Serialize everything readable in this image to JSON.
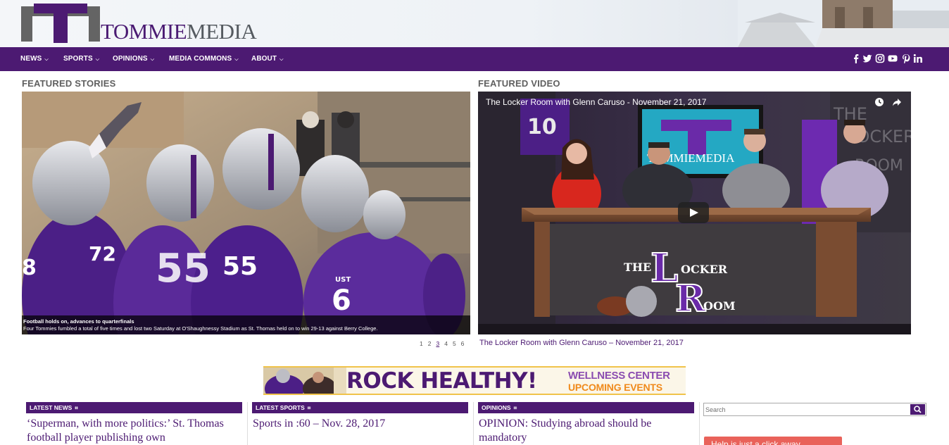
{
  "site": {
    "logo_text_part1": "TOMMIE",
    "logo_text_part2": "MEDIA",
    "brand_color": "#4c1a72"
  },
  "nav": {
    "items": [
      {
        "label": "NEWS"
      },
      {
        "label": "SPORTS"
      },
      {
        "label": "OPINIONS"
      },
      {
        "label": "MEDIA COMMONS"
      },
      {
        "label": "ABOUT"
      }
    ],
    "social_icons": [
      "facebook-icon",
      "twitter-icon",
      "instagram-icon",
      "youtube-icon",
      "pinterest-icon",
      "linkedin-icon"
    ]
  },
  "featured_stories": {
    "heading": "FEATURED STORIES",
    "caption_title": "Football holds on, advances to quarterfinals",
    "caption_text": "Four Tommies fumbled a total of five times and lost two Saturday at O'Shaughnessy Stadium as St. Thomas held on to win 29-13 against Berry College.",
    "pages": [
      "1",
      "2",
      "3",
      "4",
      "5",
      "6"
    ],
    "active_page": "3"
  },
  "featured_video": {
    "heading": "FEATURED VIDEO",
    "title": "The Locker Room with Glenn Caruso - November 21, 2017",
    "link_text": "The Locker Room with Glenn Caruso – November 21, 2017",
    "screen_logo_text": "TOMMIEMEDIA",
    "desk_text_1": "THE",
    "desk_text_2": "OCKER",
    "desk_text_3": "OOM",
    "wall_text": "THE LOCKER ROOM"
  },
  "banner": {
    "headline": "ROCK HEALTHY!",
    "line1": "WELLNESS CENTER",
    "line2": "UPCOMING EVENTS"
  },
  "columns": [
    {
      "heading": "LATEST NEWS",
      "text": "‘Superman, with more politics:’ St. Thomas football player publishing own"
    },
    {
      "heading": "LATEST SPORTS",
      "text": "Sports in :60 – Nov. 28, 2017"
    },
    {
      "heading": "OPINIONS",
      "text": "OPINION: Studying abroad should be mandatory"
    }
  ],
  "search": {
    "placeholder": "Search"
  },
  "help_bar": {
    "text": "Help is just a click away"
  }
}
